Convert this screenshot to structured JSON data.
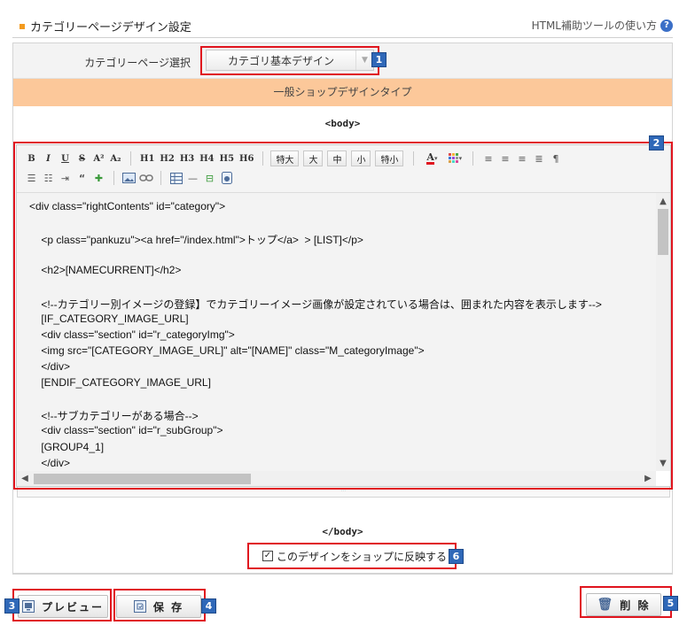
{
  "header": {
    "title": "カテゴリーページデザイン設定",
    "help_link": "HTML補助ツールの使い方",
    "help_icon": "?"
  },
  "page_select": {
    "label": "カテゴリーページ選択",
    "value": "カテゴリ基本デザイン"
  },
  "design_type": "一般ショップデザインタイプ",
  "tags": {
    "open": "<body>",
    "close": "</body>"
  },
  "toolbar": {
    "format": [
      "B",
      "I",
      "U",
      "S",
      "A²",
      "A₂"
    ],
    "headings": [
      "H1",
      "H2",
      "H3",
      "H4",
      "H5",
      "H6"
    ],
    "sizes": [
      "特大",
      "大",
      "中",
      "小",
      "特小"
    ],
    "font_color": "A"
  },
  "code_lines": [
    "<div class=\"rightContents\" id=\"category\">",
    "",
    "    <p class=\"pankuzu\"><a href=\"/index.html\">トップ</a>  > [LIST]</p>",
    "",
    "    <h2>[NAMECURRENT]</h2>",
    "",
    "    <!--カテゴリー別イメージの登録】でカテゴリーイメージ画像が設定されている場合は、囲まれた内容を表示します-->",
    "    [IF_CATEGORY_IMAGE_URL]",
    "    <div class=\"section\" id=\"r_categoryImg\">",
    "    <img src=\"[CATEGORY_IMAGE_URL]\" alt=\"[NAME]\" class=\"M_categoryImage\">",
    "    </div>",
    "    [ENDIF_CATEGORY_IMAGE_URL]",
    "",
    "    <!--サブカテゴリーがある場合-->",
    "    <div class=\"section\" id=\"r_subGroup\">",
    "    [GROUP4_1]",
    "    </div>"
  ],
  "reflect_checkbox": {
    "label": "このデザインをショップに反映する",
    "checked": true
  },
  "buttons": {
    "preview": "プレビュー",
    "save": "保 存",
    "delete": "削 除"
  },
  "callouts": [
    "1",
    "2",
    "3",
    "4",
    "5",
    "6"
  ],
  "colors": {
    "callout_red": "#e0141e",
    "badge_blue": "#2f68b8",
    "design_bar": "#fcc89a"
  }
}
